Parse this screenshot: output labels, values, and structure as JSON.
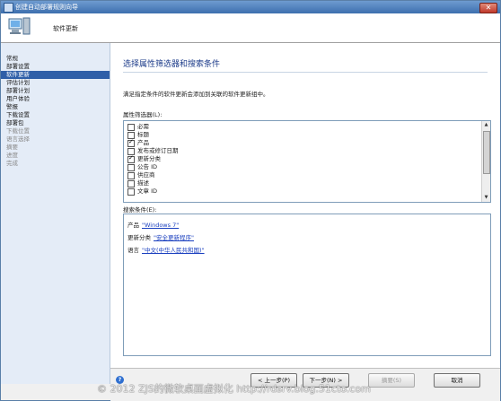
{
  "window": {
    "title": "创建自动部署规则向导"
  },
  "header": {
    "title": "软件更新"
  },
  "sidebar": {
    "items": [
      {
        "label": "常规",
        "state": "normal"
      },
      {
        "label": "部署设置",
        "state": "normal"
      },
      {
        "label": "软件更新",
        "state": "active"
      },
      {
        "label": "评估计划",
        "state": "normal"
      },
      {
        "label": "部署计划",
        "state": "normal"
      },
      {
        "label": "用户体验",
        "state": "normal"
      },
      {
        "label": "警报",
        "state": "normal"
      },
      {
        "label": "下载设置",
        "state": "normal"
      },
      {
        "label": "部署包",
        "state": "normal"
      },
      {
        "label": "下载位置",
        "state": "disabled"
      },
      {
        "label": "语言选择",
        "state": "disabled"
      },
      {
        "label": "摘要",
        "state": "disabled"
      },
      {
        "label": "进度",
        "state": "disabled"
      },
      {
        "label": "完成",
        "state": "disabled"
      }
    ]
  },
  "main": {
    "title": "选择属性筛选器和搜索条件",
    "description": "满足指定条件的软件更新会添加到关联的软件更新组中。",
    "filters_label": "属性筛选器(L):",
    "filters": [
      {
        "label": "必需",
        "checked": false
      },
      {
        "label": "标题",
        "checked": false
      },
      {
        "label": "产品",
        "checked": true
      },
      {
        "label": "发布或修订日期",
        "checked": false
      },
      {
        "label": "更新分类",
        "checked": true
      },
      {
        "label": "公告 ID",
        "checked": false
      },
      {
        "label": "供应商",
        "checked": false
      },
      {
        "label": "描述",
        "checked": false
      },
      {
        "label": "文章 ID",
        "checked": false
      }
    ],
    "criteria_label": "搜索条件(E):",
    "criteria": [
      {
        "name": "产品",
        "value": "\"Windows 7\""
      },
      {
        "name": "更新分类",
        "value": "\"安全更新程序\""
      },
      {
        "name": "语言",
        "value": "\"中文(中华人民共和国)\""
      }
    ]
  },
  "footer": {
    "prev_label": "< 上一步(P)",
    "next_label": "下一步(N) >",
    "summary_label": "摘要(S)",
    "cancel_label": "取消"
  },
  "watermark": "© 2012 ZJS的微软桌面虚拟化 http://rdsrv.blog.51cto.com"
}
